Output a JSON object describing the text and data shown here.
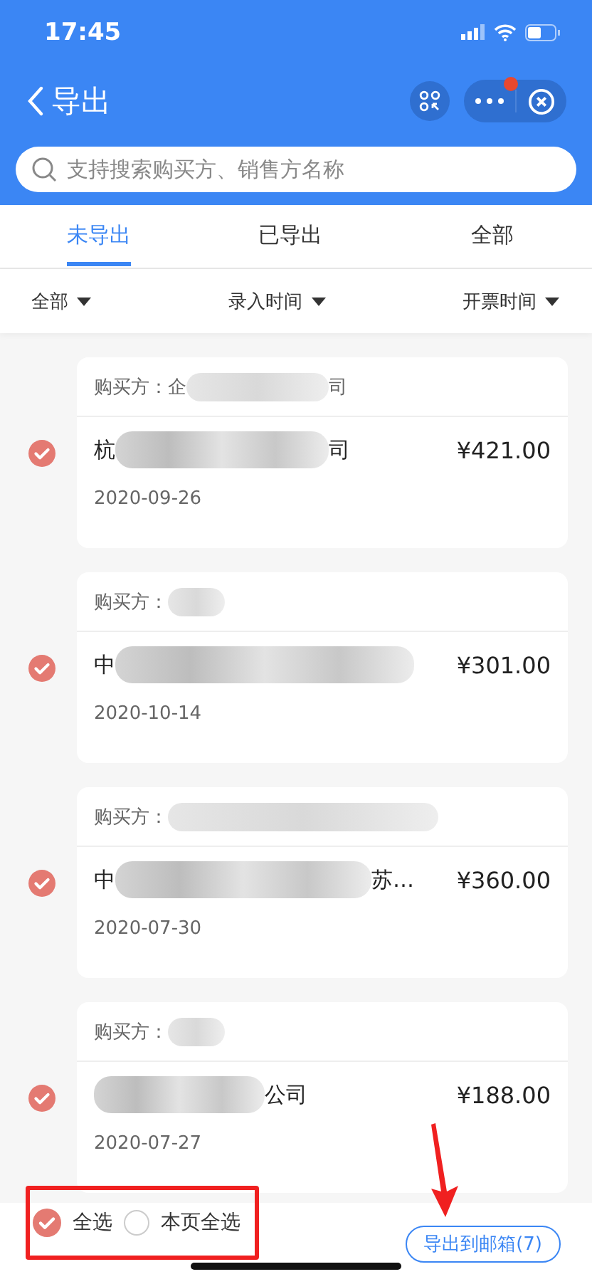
{
  "status_bar": {
    "time": "17:45"
  },
  "nav": {
    "title": "导出",
    "badge": true
  },
  "search": {
    "placeholder": "支持搜索购买方、销售方名称"
  },
  "tabs": [
    {
      "label": "未导出",
      "selected": true
    },
    {
      "label": "已导出",
      "selected": false
    },
    {
      "label": "全部",
      "selected": false
    }
  ],
  "filters": [
    {
      "label": "全部"
    },
    {
      "label": "录入时间"
    },
    {
      "label": "开票时间"
    }
  ],
  "invoices": [
    {
      "checked": true,
      "buyer_label": "购买方：",
      "buyer_start": "企",
      "buyer_end": "司",
      "seller_start": "杭",
      "seller_end": "司",
      "amount": "¥421.00",
      "date": "2020-09-26"
    },
    {
      "checked": true,
      "buyer_label": "购买方：",
      "seller_start": "中",
      "amount": "¥301.00",
      "date": "2020-10-14"
    },
    {
      "checked": true,
      "buyer_label": "购买方：",
      "seller_start": "中",
      "seller_end": "苏…",
      "amount": "¥360.00",
      "date": "2020-07-30"
    },
    {
      "checked": true,
      "buyer_label": "购买方：",
      "seller_end": "公司",
      "amount": "¥188.00",
      "date": "2020-07-27"
    }
  ],
  "footer": {
    "select_all": {
      "label": "全选",
      "checked": true
    },
    "select_page": {
      "label": "本页全选",
      "checked": false
    },
    "export_button": "导出到邮箱(7)"
  }
}
